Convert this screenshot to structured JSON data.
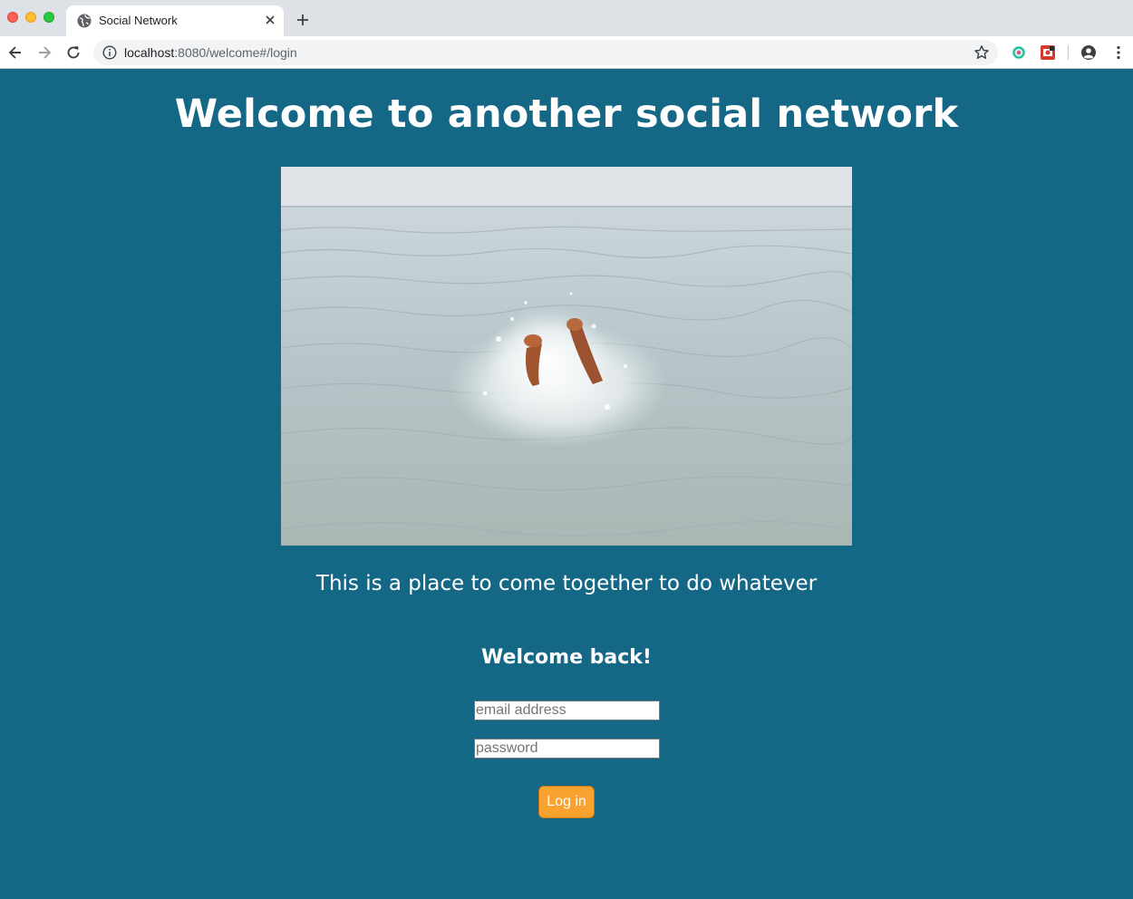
{
  "browser": {
    "tab_title": "Social Network",
    "url_host": "localhost",
    "url_rest": ":8080/welcome#/login"
  },
  "page": {
    "headline": "Welcome to another social network",
    "hero_image_alt": "",
    "tagline": "This is a place to come together to do whatever",
    "login": {
      "heading": "Welcome back!",
      "email_placeholder": "email address",
      "password_placeholder": "password",
      "submit_label": "Log in"
    }
  },
  "colors": {
    "page_background": "#156786",
    "button_background": "#f9a22f",
    "text": "#ffffff"
  }
}
